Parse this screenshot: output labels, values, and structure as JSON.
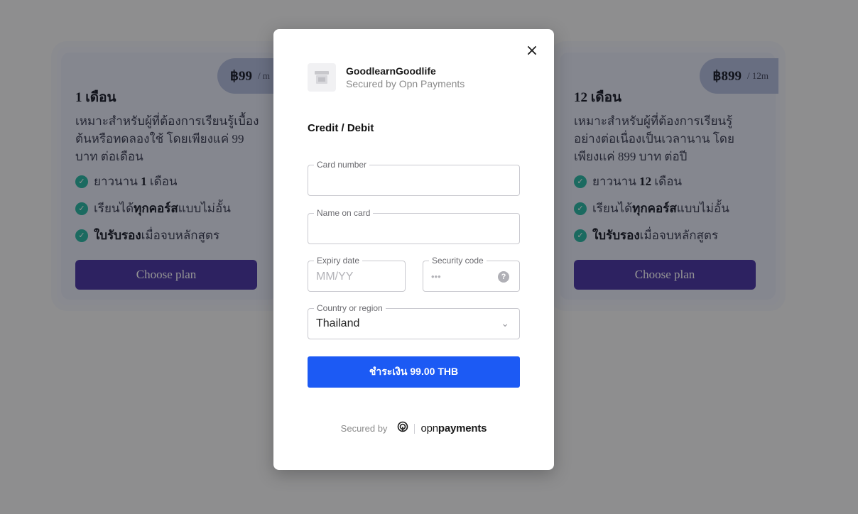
{
  "plans": [
    {
      "price": "฿99",
      "unit": "/ m",
      "title": "1 เดือน",
      "description": "เหมาะสำหรับผู้ที่ต้องการเรียนรู้เบื้องต้นหรือทดลองใช้ โดยเพียงแค่ 99 บาท ต่อเดือน",
      "feature1_prefix": "ยาวนาน ",
      "feature1_bold": "1",
      "feature1_suffix": " เดือน",
      "feature2_prefix": "เรียนได้",
      "feature2_bold": "ทุกคอร์ส",
      "feature2_suffix": "แบบไม่อั้น",
      "feature3_bold": "ใบรับรอง",
      "feature3_suffix": "เมื่อจบหลักสูตร",
      "button": "Choose plan"
    },
    {
      "price": "฿899",
      "unit": "/ 12m",
      "title": "12 เดือน",
      "description": "เหมาะสำหรับผู้ที่ต้องการเรียนรู้อย่างต่อเนื่องเป็นเวลานาน โดยเพียงแค่ 899 บาท ต่อปี",
      "feature1_prefix": "ยาวนาน ",
      "feature1_bold": "12",
      "feature1_suffix": " เดือน",
      "feature2_prefix": "เรียนได้",
      "feature2_bold": "ทุกคอร์ส",
      "feature2_suffix": "แบบไม่อั้น",
      "feature3_bold": "ใบรับรอง",
      "feature3_suffix": "เมื่อจบหลักสูตร",
      "button": "Choose plan"
    }
  ],
  "checkout": {
    "close_icon": "×",
    "merchant_name": "GoodlearnGoodlife",
    "merchant_sub": "Secured by Opn Payments",
    "section_title": "Credit / Debit",
    "card_number_label": "Card number",
    "name_label": "Name on card",
    "expiry_label": "Expiry date",
    "expiry_placeholder": "MM/YY",
    "cvc_label": "Security code",
    "cvc_placeholder": "•••",
    "cvc_help": "?",
    "country_label": "Country or region",
    "country_value": "Thailand",
    "pay_button": "ชำระเงิน 99.00 THB",
    "footer_secured": "Secured by",
    "footer_brand_light": "opn",
    "footer_brand_bold": "payments"
  },
  "colors": {
    "pay_button": "#1c5af4",
    "choose_button": "#4f3ca8",
    "check": "#2fb7a6"
  }
}
